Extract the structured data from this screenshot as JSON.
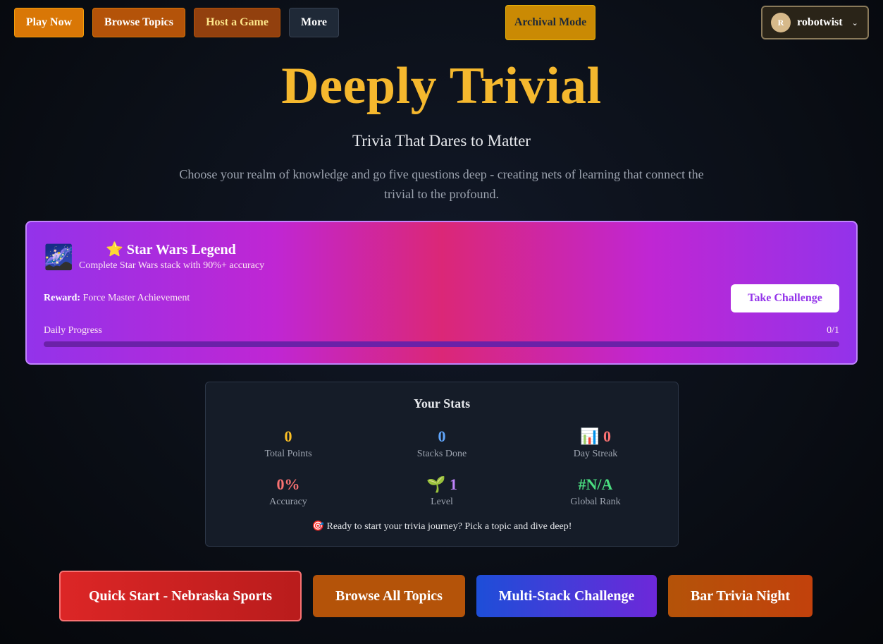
{
  "nav": {
    "play_now": "Play Now",
    "browse_topics": "Browse Topics",
    "host_game": "Host a Game",
    "more": "More",
    "archival_mode": "Archival Mode",
    "user": {
      "initial": "R",
      "name": "robotwist"
    }
  },
  "hero": {
    "title": "Deeply Trivial",
    "tagline": "Trivia That Dares to Matter",
    "description": "Choose your realm of knowledge and go five questions deep - creating nets of learning that connect the trivial to the profound."
  },
  "challenge": {
    "icon": "🌌",
    "title": "⭐ Star Wars Legend",
    "subtitle": "Complete Star Wars stack with 90%+ accuracy",
    "reward_label": "Reward:",
    "reward_value": "Force Master Achievement",
    "button": "Take Challenge",
    "progress_label": "Daily Progress",
    "progress_value": "0/1",
    "progress_fraction": 0
  },
  "stats": {
    "title": "Your Stats",
    "items": [
      {
        "value": "0",
        "label": "Total Points",
        "color": "#fbbf24"
      },
      {
        "value": "0",
        "label": "Stacks Done",
        "color": "#60a5fa"
      },
      {
        "value": "📊 0",
        "label": "Day Streak",
        "color": "#f87171"
      },
      {
        "value": "0%",
        "label": "Accuracy",
        "color": "#f87171"
      },
      {
        "value": "🌱 1",
        "label": "Level",
        "color": "#c084fc"
      },
      {
        "value": "#N/A",
        "label": "Global Rank",
        "color": "#4ade80"
      }
    ],
    "message": "🎯 Ready to start your trivia journey? Pick a topic and dive deep!"
  },
  "actions": {
    "quick_start": "Quick Start - Nebraska Sports",
    "browse_all": "Browse All Topics",
    "multi_stack": "Multi-Stack Challenge",
    "bar_trivia": "Bar Trivia Night"
  }
}
